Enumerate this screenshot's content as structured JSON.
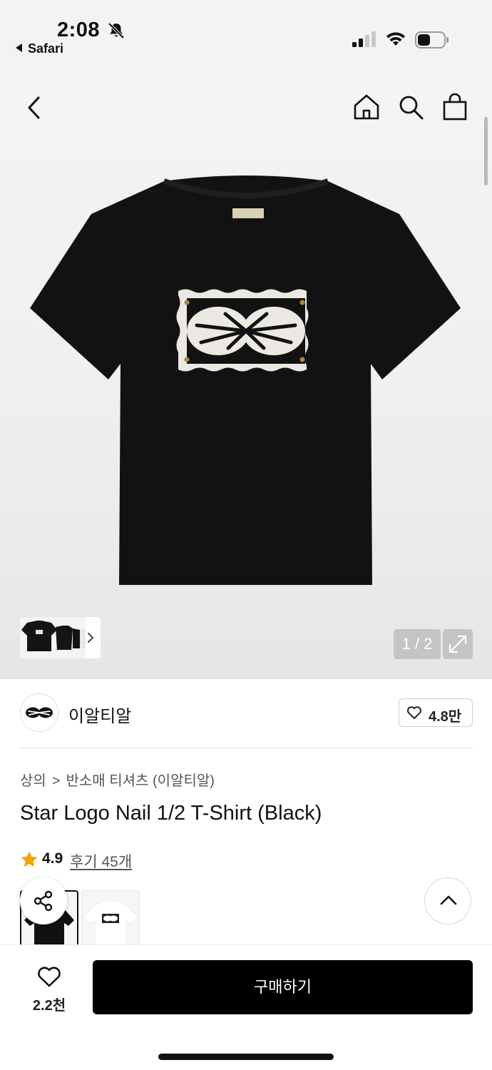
{
  "status_bar": {
    "time": "2:08",
    "back_app": "Safari",
    "icons": [
      "bell-slash-icon",
      "cellular-signal-icon",
      "wifi-icon",
      "battery-icon"
    ]
  },
  "nav": {
    "icons": [
      "back-chevron-icon",
      "home-icon",
      "search-icon",
      "shopping-bag-icon"
    ]
  },
  "gallery": {
    "counter": "1 / 2",
    "expand_icon": "expand-icon"
  },
  "brand": {
    "name": "이알티알",
    "likes": "4.8만"
  },
  "product": {
    "breadcrumb": [
      "상의",
      "반소매 티셔츠 (이알티알)"
    ],
    "title": "Star Logo Nail 1/2 T-Shirt (Black)",
    "rating": "4.9",
    "reviews": "후기 45개"
  },
  "colors": {
    "accent_star": "#f5a200",
    "shirt_black": "#121212",
    "buy_button": "#000000"
  },
  "bottom_bar": {
    "wish_count": "2.2천",
    "buy_label": "구매하기"
  }
}
